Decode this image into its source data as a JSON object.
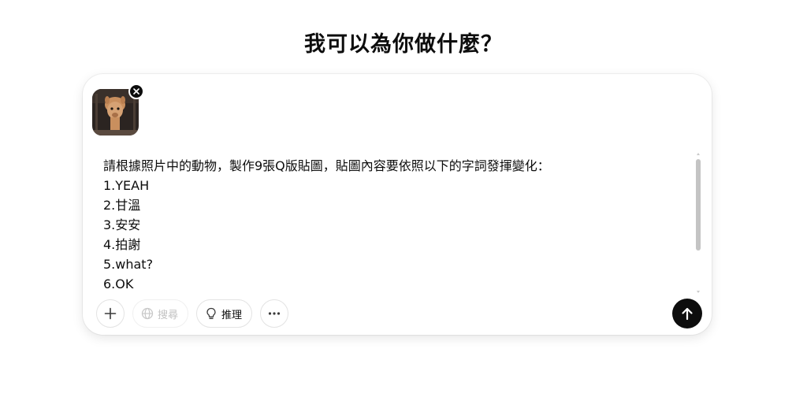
{
  "heading": "我可以為你做什麼？",
  "composer": {
    "attachment": {
      "icon": "alpaca-photo",
      "remove_icon": "close-icon"
    },
    "prompt_lines": [
      "請根據照片中的動物，製作9張Q版貼圖，貼圖內容要依照以下的字詞發揮變化：",
      "1.YEAH",
      "2.甘溫",
      "3.安安",
      "4.拍謝",
      "5.what?",
      "6.OK"
    ],
    "toolbar": {
      "add_icon": "plus-icon",
      "search_label": "搜尋",
      "search_icon": "globe-icon",
      "reason_label": "推理",
      "reason_icon": "lightbulb-icon",
      "more_icon": "more-icon"
    },
    "send_icon": "arrow-up-icon"
  },
  "colors": {
    "send_button": "#0d0d0d",
    "disabled_text": "#c2c2c2",
    "border": "#e3e3e3"
  }
}
